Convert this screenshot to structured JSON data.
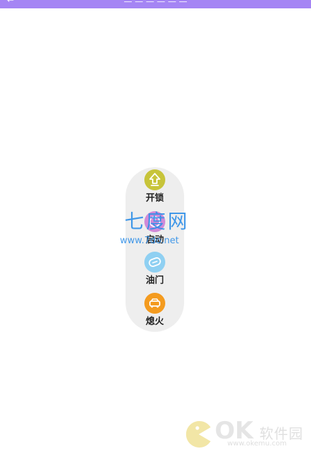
{
  "top_bar": {
    "back_glyph": "←",
    "title": "一 一 一 一 一 一"
  },
  "panel": {
    "items": [
      {
        "label": "开锁",
        "icon": "unlock-icon",
        "color": "#c7c43a"
      },
      {
        "label": "启动",
        "icon": "start-icon",
        "color": "#d08ad8"
      },
      {
        "label": "油门",
        "icon": "throttle-icon",
        "color": "#8fd0f2"
      },
      {
        "label": "熄火",
        "icon": "engine-off-icon",
        "color": "#f49b1f"
      }
    ]
  },
  "watermark_center": {
    "title": "七度网",
    "site": "www.7do.net"
  },
  "watermark_corner": {
    "brand": "OK",
    "name": "软件园",
    "site": "www.okemu.com"
  },
  "colors": {
    "top_bar": "#a585f4",
    "panel_bg": "#eeeeee",
    "watermark_blue": "#2f8fe8"
  }
}
